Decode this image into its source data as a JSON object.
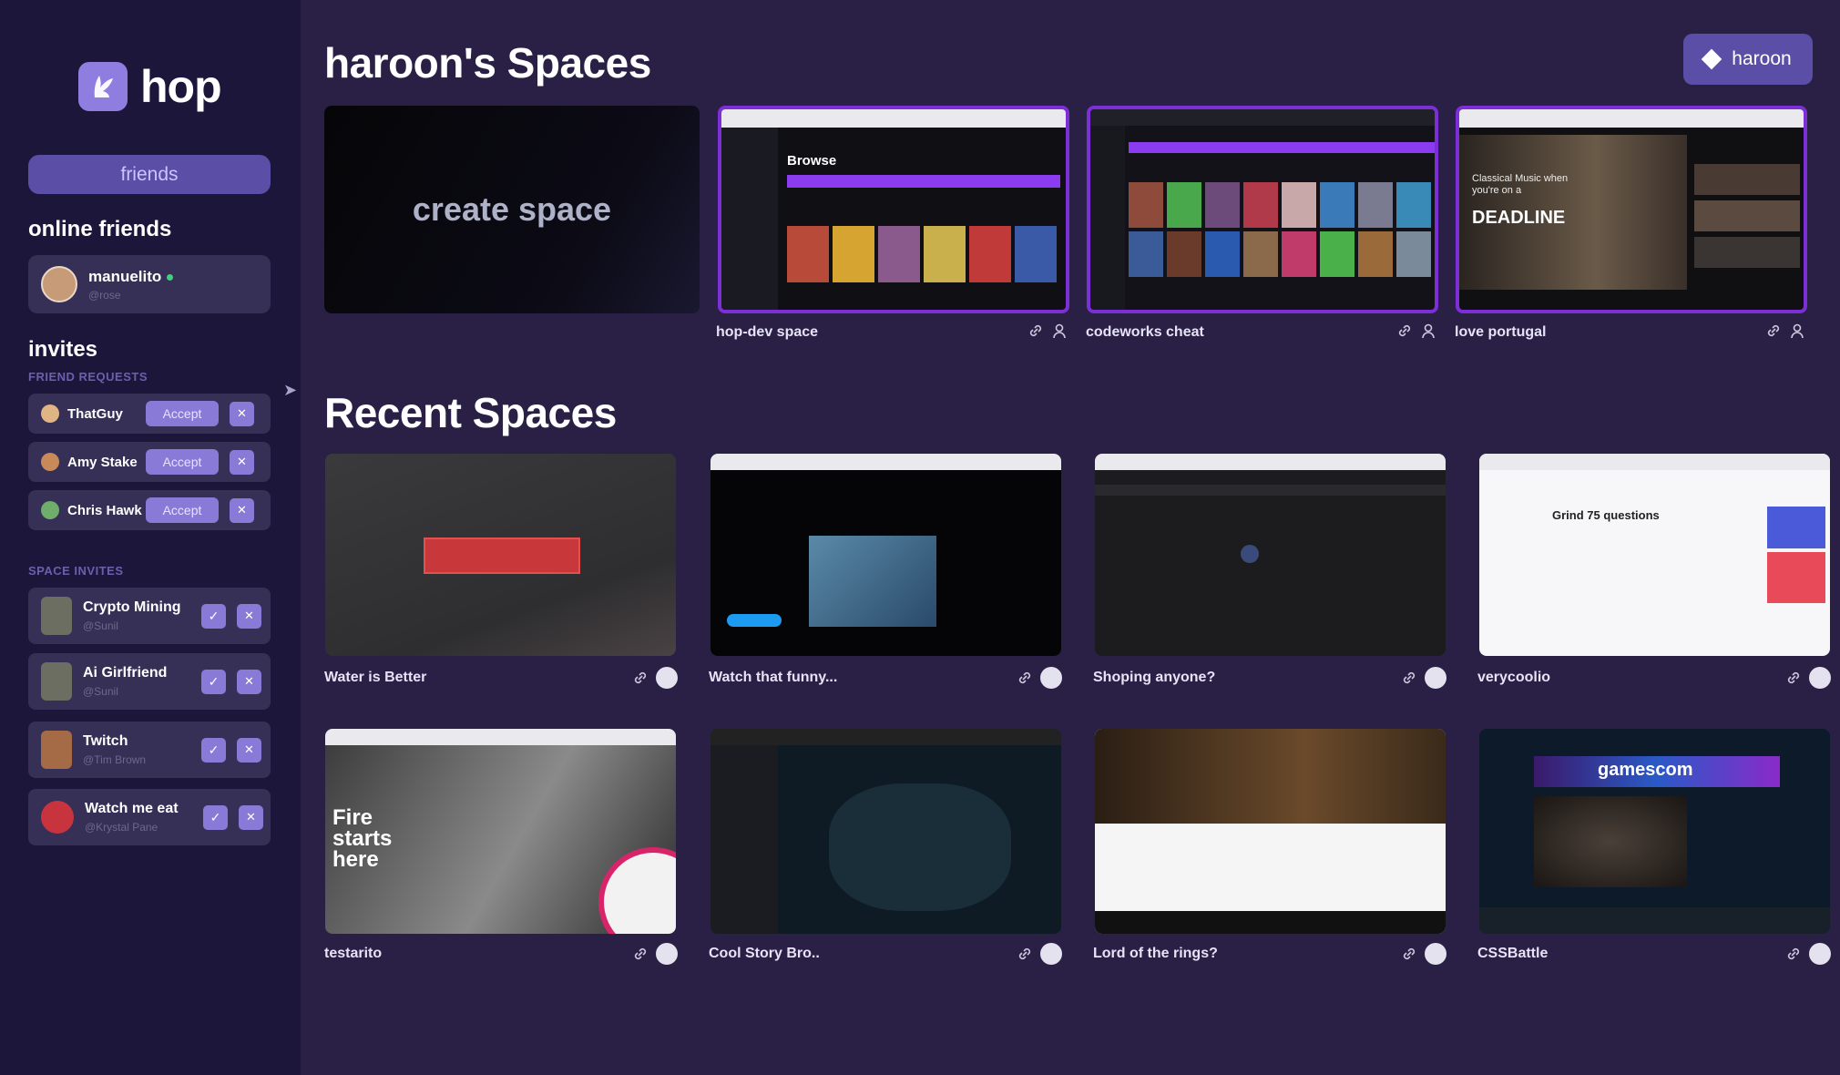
{
  "app": {
    "name": "hop"
  },
  "sidebar": {
    "friends_button": "friends",
    "online_title": "online friends",
    "online": [
      {
        "name": "manuelito",
        "handle": "@rose"
      }
    ],
    "invites_title": "invites",
    "friend_requests_label": "FRIEND REQUESTS",
    "friend_requests": [
      {
        "name": "ThatGuy",
        "accept": "Accept",
        "reject": "✕",
        "avatar_color": "#e0b584"
      },
      {
        "name": "Amy Stake",
        "accept": "Accept",
        "reject": "✕",
        "avatar_color": "#c98a5a"
      },
      {
        "name": "Chris Hawk",
        "accept": "Accept",
        "reject": "✕",
        "avatar_color": "#6fae6a"
      }
    ],
    "space_invites_label": "SPACE INVITES",
    "space_invites": [
      {
        "name": "Crypto Mining",
        "handle": "@Sunil",
        "avatar_color": "#6c6e62"
      },
      {
        "name": "Ai Girlfriend",
        "handle": "@Sunil",
        "avatar_color": "#6c6e62"
      },
      {
        "name": "Twitch",
        "handle": "@Tim Brown",
        "avatar_color": "#a46b46"
      },
      {
        "name": "Watch me eat",
        "handle": "@Krystal Pane",
        "avatar_color": "#c8343e"
      }
    ]
  },
  "header": {
    "title": "haroon's Spaces",
    "user_button": "haroon"
  },
  "my_spaces": {
    "create_label": "create space",
    "items": [
      {
        "name": "hop-dev space"
      },
      {
        "name": "codeworks cheat"
      },
      {
        "name": "love portugal"
      }
    ]
  },
  "recent": {
    "title": "Recent Spaces",
    "items": [
      {
        "name": "Water is Better"
      },
      {
        "name": "Watch that funny..."
      },
      {
        "name": "Shoping anyone?"
      },
      {
        "name": "verycoolio"
      },
      {
        "name": "testarito"
      },
      {
        "name": "Cool Story Bro.."
      },
      {
        "name": "Lord of the rings?"
      },
      {
        "name": "CSSBattle"
      }
    ]
  },
  "thumb_text": {
    "browse": "Browse",
    "deadline": "DEADLINE",
    "classical": "Classical Music when you're on a",
    "grind": "Grind 75 questions",
    "fire": [
      "Fire",
      "starts",
      "here"
    ],
    "gamescom": "gamescom"
  },
  "colors": {
    "sidebar_bg": "#1d163b",
    "main_bg": "#2a2046",
    "accent": "#8a7ad8",
    "purple_border": "#7c2fd6"
  }
}
